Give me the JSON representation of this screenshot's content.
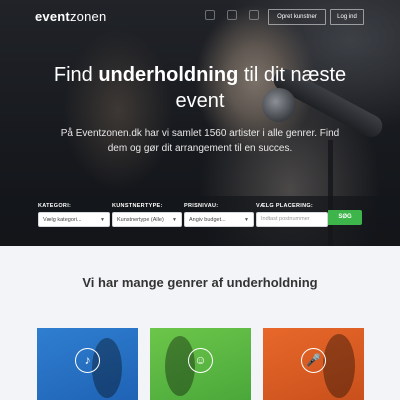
{
  "header": {
    "logo_bold": "event",
    "logo_light": "zonen",
    "create_profile": "Opret kunstner",
    "login": "Log ind"
  },
  "hero": {
    "headline_pre": "Find ",
    "headline_bold": "underholdning",
    "headline_post": " til dit næste event",
    "subline": "På Eventzonen.dk har vi samlet 1560 artister i alle genrer. Find dem og gør dit arrangement til en succes."
  },
  "search": {
    "category": {
      "label": "KATEGORI:",
      "value": "Vælg kategori..."
    },
    "artist_type": {
      "label": "KUNSTNERTYPE:",
      "value": "Kunstnertype (Alle)"
    },
    "price": {
      "label": "PRISNIVAU:",
      "value": "Angiv budget..."
    },
    "location": {
      "label": "VÆLG PLACERING:",
      "placeholder": "Indtast postnummer"
    },
    "button": "SØG"
  },
  "section": {
    "title_pre": "Vi har mange genrer af ",
    "title_bold": "underholdning"
  },
  "cards": [
    {
      "icon": "guitar-icon",
      "color": "#2f7ed0"
    },
    {
      "icon": "theater-masks-icon",
      "color": "#6cc64a"
    },
    {
      "icon": "microphone-icon",
      "color": "#e8682a"
    }
  ]
}
